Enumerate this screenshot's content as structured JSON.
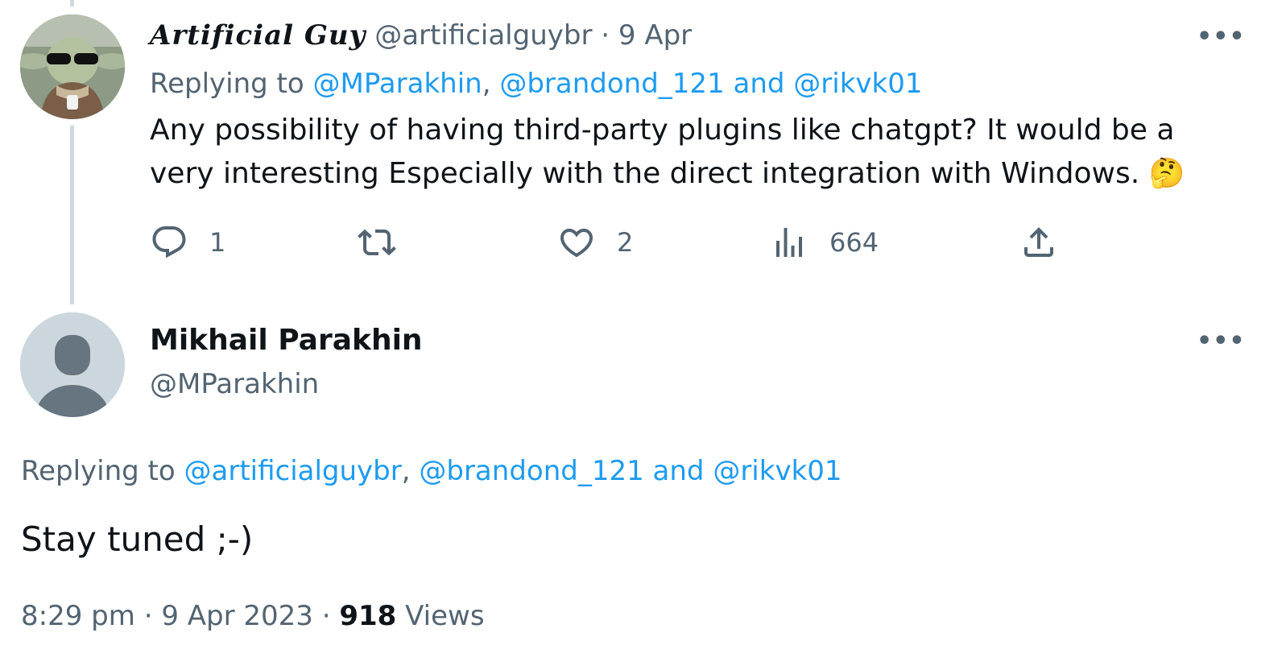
{
  "tweet1": {
    "display_name": "Artificial Guy",
    "handle": "@artificialguybr",
    "separator": "·",
    "date": "9 Apr",
    "replying_prefix": "Replying to",
    "reply_mention1": "@MParakhin",
    "reply_sep": ",",
    "reply_mention2": "@brandond_121",
    "reply_and": "and",
    "reply_mention3": "@rikvk01",
    "text_line1": "Any possibility of having third-party plugins like  chatgpt? It would be a",
    "text_line2": "very interesting  Especially  with the direct integration with Windows.",
    "emoji": "🤔",
    "more_label": "•••",
    "reply_count": "1",
    "retweet_count": "",
    "like_count": "2",
    "views_count": "664",
    "icons": [
      "reply-icon",
      "retweet-icon",
      "like-icon",
      "views-icon",
      "share-icon"
    ]
  },
  "tweet2": {
    "display_name": "Mikhail Parakhin",
    "handle": "@MParakhin",
    "more_label": "•••",
    "replying_prefix": "Replying to",
    "reply_mention1": "@artificialguybr",
    "reply_sep": ",",
    "reply_mention2": "@brandond_121",
    "reply_and": "and",
    "reply_mention3": "@rikvk01",
    "text": "Stay tuned ;-)",
    "time": "8:29 pm",
    "dot": "·",
    "date": "9 Apr 2023",
    "views_number": "918",
    "views_label": "Views"
  },
  "colors": {
    "link": "#1d9bf0",
    "secondary": "#536471",
    "text": "#0f1419",
    "thread": "#cfd9de"
  }
}
